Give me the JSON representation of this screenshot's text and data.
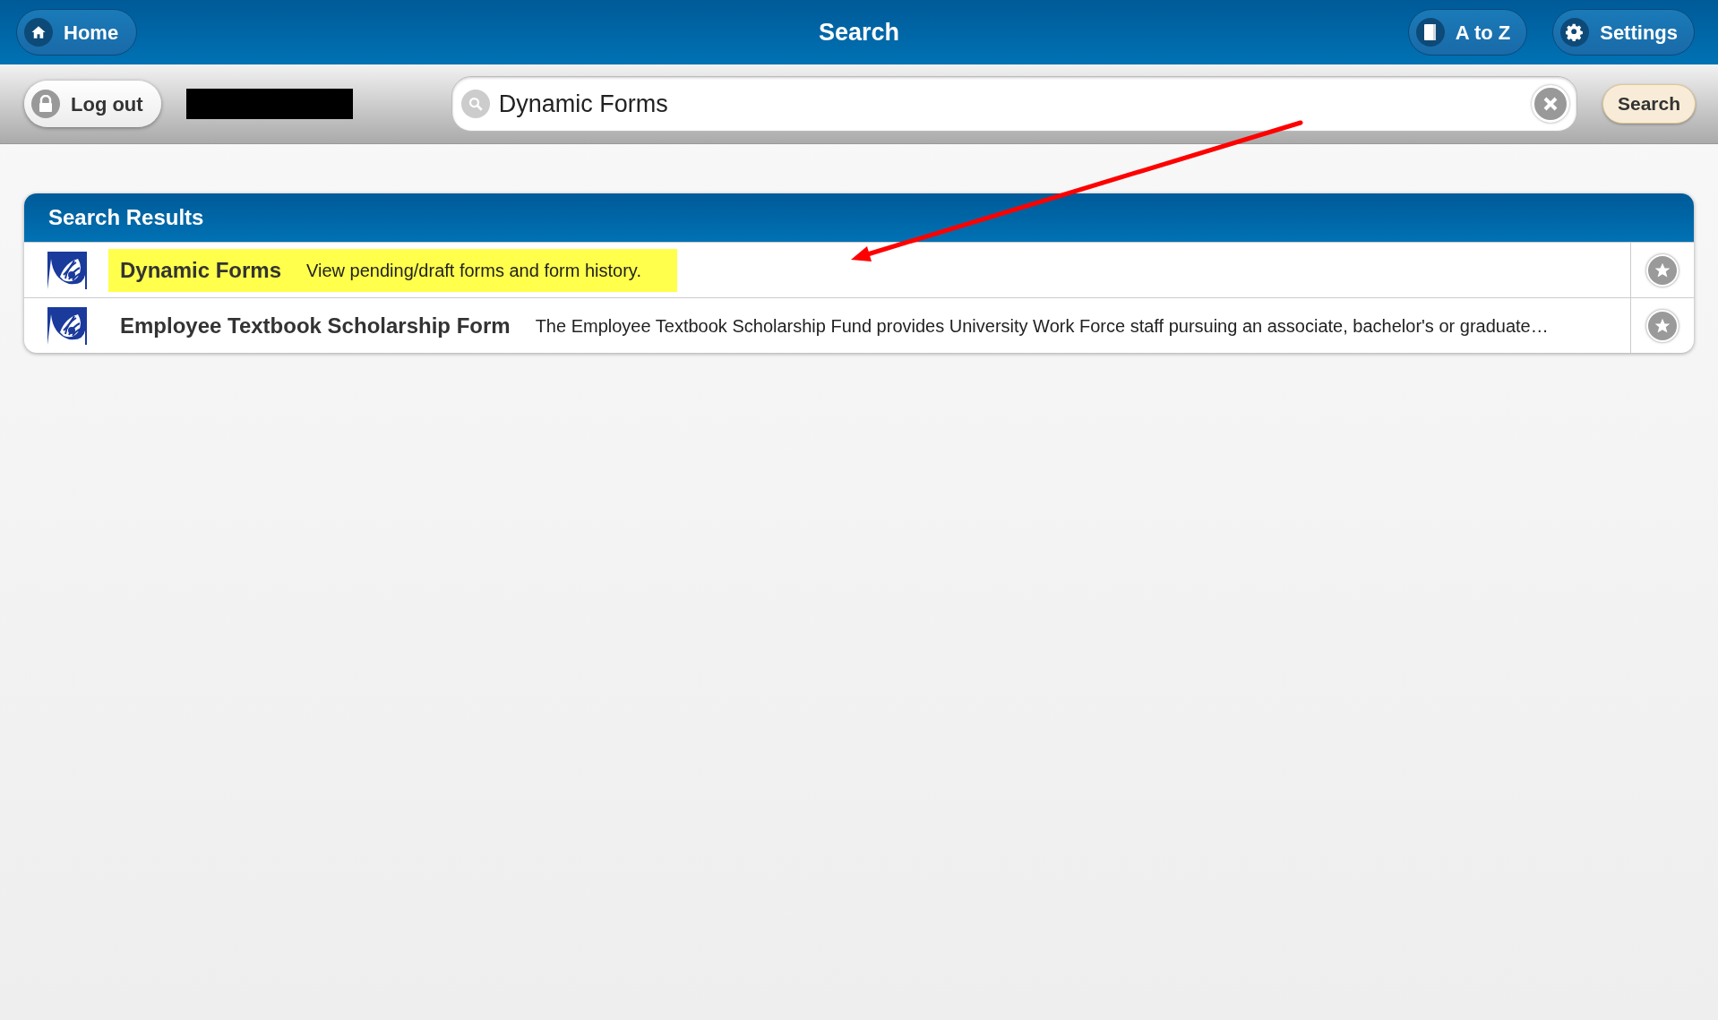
{
  "header": {
    "title": "Search",
    "home_button": "Home",
    "atoz_button": "A to Z",
    "settings_button": "Settings"
  },
  "toolbar": {
    "logout_button": "Log out",
    "search_field": {
      "value": "Dynamic Forms"
    },
    "search_button": "Search"
  },
  "results": {
    "title": "Search Results",
    "rows": [
      {
        "name": "Dynamic Forms",
        "description": "View pending/draft forms and form history.",
        "highlighted": true
      },
      {
        "name": "Employee Textbook Scholarship Form",
        "description": "The Employee Textbook Scholarship Fund provides University Work Force staff pursuing an associate, bachelor's or graduate…",
        "highlighted": false
      }
    ]
  }
}
